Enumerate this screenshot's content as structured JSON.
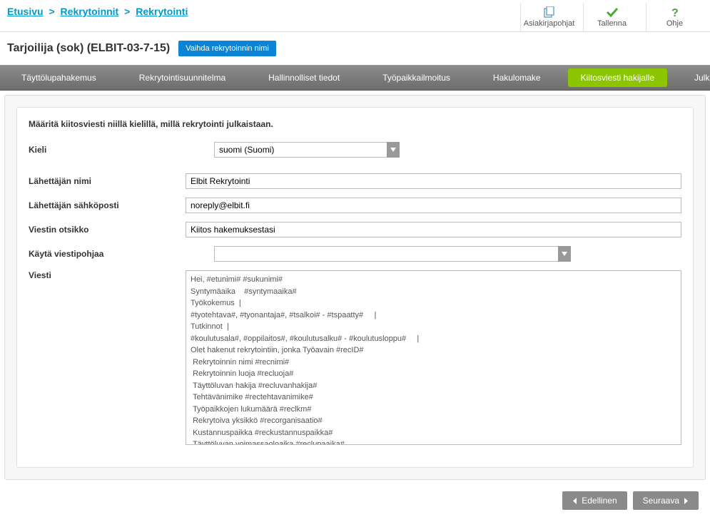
{
  "breadcrumb": {
    "home": "Etusivu",
    "mid": "Rekrytoinnit",
    "current": "Rekrytointi"
  },
  "actions": {
    "templates": "Asiakirjapohjat",
    "save": "Tallenna",
    "help": "Ohje"
  },
  "page": {
    "title": "Tarjoilija (sok) (ELBIT-03-7-15)",
    "rename": "Vaihda rekrytoinnin nimi"
  },
  "tabs": {
    "perm": "Täyttölupahakemus",
    "plan": "Rekrytointisuunnitelma",
    "admin": "Hallinnolliset tiedot",
    "ad": "Työpaikkailmoitus",
    "form": "Hakulomake",
    "thanks": "Kiitosviesti hakijalle",
    "publish": "Julkaisu"
  },
  "intro": "Määritä kiitosviesti niillä kielillä, millä rekrytointi julkaistaan.",
  "labels": {
    "lang": "Kieli",
    "sender_name": "Lähettäjän nimi",
    "sender_email": "Lähettäjän sähköposti",
    "subject": "Viestin otsikko",
    "template": "Käytä viestipohjaa",
    "body": "Viesti"
  },
  "values": {
    "lang": "suomi (Suomi)",
    "sender_name": "Elbit Rekrytointi",
    "sender_email": "noreply@elbit.fi",
    "subject": "Kiitos hakemuksestasi",
    "template": "",
    "body": "Hei, #etunimi# #sukunimi#\nSyntymäaika    #syntymaaika#\nTyökokemus  |\n#tyotehtava#, #tyonantaja#, #tsalkoi# - #tspaatty#     |\nTutkinnot  |\n#koulutusala#, #oppilaitos#, #koulutusalku# - #koulutusloppu#     |\nOlet hakenut rekrytointiin, jonka Työavain #recID#\n Rekrytoinnin nimi #recnimi#\n Rekrytoinnin luoja #recluoja#\n Täyttöluvan hakija #recluvanhakija#\n Tehtävänimike #rectehtavanimike#\n Työpaikkojen lukumäärä #reclkm#\n Rekrytoiva yksikkö #recorganisaatio#\n Kustannuspaikka #reckustannuspaikka#\n Täyttöluvan voimassaoloaika #reclupaaika#\n Suunniteltu hakuaika #rechakuaika#\n Rekrytointimenetelmät #taytrecmenetelma#\n Ovatko määrärahat budjetissa #recrahatbudjetissa#"
  },
  "nav": {
    "prev": "Edellinen",
    "next": "Seuraava"
  }
}
